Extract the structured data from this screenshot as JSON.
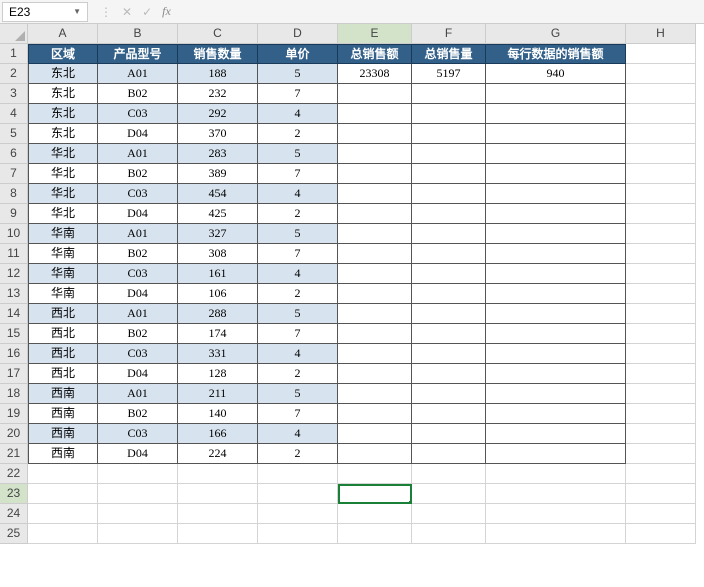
{
  "namebox": {
    "value": "E23"
  },
  "columns": [
    "A",
    "B",
    "C",
    "D",
    "E",
    "F",
    "G",
    "H"
  ],
  "headers": {
    "A": "区域",
    "B": "产品型号",
    "C": "销售数量",
    "D": "单价",
    "E": "总销售额",
    "F": "总销售量",
    "G": "每行数据的销售额"
  },
  "chart_data": {
    "type": "table",
    "columns": [
      "区域",
      "产品型号",
      "销售数量",
      "单价",
      "总销售额",
      "总销售量",
      "每行数据的销售额"
    ],
    "rows": [
      [
        "东北",
        "A01",
        188,
        5,
        23308,
        5197,
        940
      ],
      [
        "东北",
        "B02",
        232,
        7,
        "",
        "",
        ""
      ],
      [
        "东北",
        "C03",
        292,
        4,
        "",
        "",
        ""
      ],
      [
        "东北",
        "D04",
        370,
        2,
        "",
        "",
        ""
      ],
      [
        "华北",
        "A01",
        283,
        5,
        "",
        "",
        ""
      ],
      [
        "华北",
        "B02",
        389,
        7,
        "",
        "",
        ""
      ],
      [
        "华北",
        "C03",
        454,
        4,
        "",
        "",
        ""
      ],
      [
        "华北",
        "D04",
        425,
        2,
        "",
        "",
        ""
      ],
      [
        "华南",
        "A01",
        327,
        5,
        "",
        "",
        ""
      ],
      [
        "华南",
        "B02",
        308,
        7,
        "",
        "",
        ""
      ],
      [
        "华南",
        "C03",
        161,
        4,
        "",
        "",
        ""
      ],
      [
        "华南",
        "D04",
        106,
        2,
        "",
        "",
        ""
      ],
      [
        "西北",
        "A01",
        288,
        5,
        "",
        "",
        ""
      ],
      [
        "西北",
        "B02",
        174,
        7,
        "",
        "",
        ""
      ],
      [
        "西北",
        "C03",
        331,
        4,
        "",
        "",
        ""
      ],
      [
        "西北",
        "D04",
        128,
        2,
        "",
        "",
        ""
      ],
      [
        "西南",
        "A01",
        211,
        5,
        "",
        "",
        ""
      ],
      [
        "西南",
        "B02",
        140,
        7,
        "",
        "",
        ""
      ],
      [
        "西南",
        "C03",
        166,
        4,
        "",
        "",
        ""
      ],
      [
        "西南",
        "D04",
        224,
        2,
        "",
        "",
        ""
      ]
    ]
  },
  "selection": {
    "row": 23,
    "col": "E"
  },
  "visible_rows": 25
}
